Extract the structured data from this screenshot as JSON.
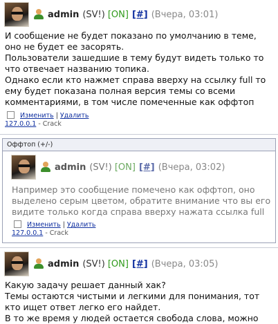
{
  "posts": [
    {
      "author": "admin",
      "role": "(SV!)",
      "status": "[ON]",
      "anchor": "[#]",
      "date": "(Вчера, 03:01)",
      "lines": [
        "И сообщение не будет показано по умолчанию в теме, оно не будет ее засорять.",
        "Пользователи зашедшие в тему будут видеть только то что отвечает названию топика.",
        "Однако если кто нажмет справа вверху на ссылку full то ему будет показана полная версия темы со всеми комментариями, в том числе помеченные как оффтоп"
      ],
      "edit_label": "Изменить",
      "separator": "|",
      "delete_label": "Удалить",
      "ip": "127.0.0.1",
      "meta_suffix": " - Crack"
    },
    {
      "author": "admin",
      "role": "(SV!)",
      "status": "[ON]",
      "anchor": "[#]",
      "date": "(Вчера, 03:05)",
      "lines": [
        "Какую задачу решает данный хак?",
        "Темы остаются чистыми и легкими для понимания, тот кто ищет ответ легко его найдет.",
        "В то же время у людей остается свобода слова, можно"
      ]
    }
  ],
  "offtopic": {
    "title": "Оффтоп (+/-)",
    "post": {
      "author": "admin",
      "role": "(SV!)",
      "status": "[ON]",
      "anchor": "[#]",
      "date": "(Вчера, 03:02)",
      "text": "Например это сообщение помечено как оффтоп, оно выделено серым цветом, обратите внимание что вы его видите только когда справа вверху нажата ссылка full",
      "edit_label": "Изменить",
      "separator": "|",
      "delete_label": "Удалить",
      "ip": "127.0.0.1",
      "meta_suffix": " - Crack"
    }
  },
  "colors": {
    "status_green": "#2f9a1a",
    "link_blue": "#1030a0",
    "date_gray": "#888888",
    "offtopic_border": "#9aa0b5"
  },
  "icons": [
    "avatar",
    "user-icon"
  ]
}
